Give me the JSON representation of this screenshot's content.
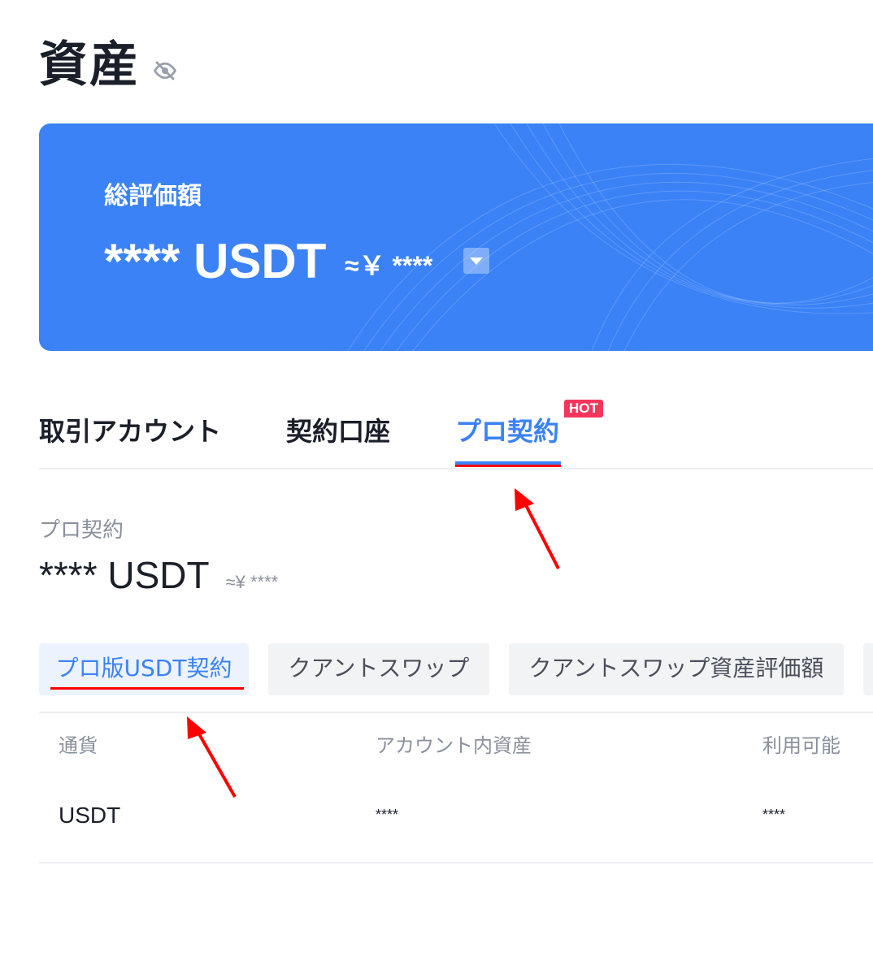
{
  "page": {
    "title": "資産"
  },
  "banner": {
    "label": "総評価額",
    "amount": "**** USDT",
    "approx": "≈￥ ****"
  },
  "tabs": [
    {
      "label": "取引アカウント"
    },
    {
      "label": "契約口座"
    },
    {
      "label": "プロ契約",
      "badge": "HOT",
      "active": true
    }
  ],
  "section": {
    "label": "プロ契約",
    "amount": "**** USDT",
    "approx": "≈¥ ****"
  },
  "subtabs": [
    {
      "label": "プロ版USDT契約",
      "active": true
    },
    {
      "label": "クアントスワップ"
    },
    {
      "label": "クアントスワップ資産評価額"
    }
  ],
  "table": {
    "headers": [
      "通貨",
      "アカウント内資産",
      "利用可能"
    ],
    "rows": [
      {
        "currency": "USDT",
        "account_assets": "****",
        "available": "****"
      }
    ]
  },
  "colors": {
    "accent": "#3b82f7",
    "hot_badge": "#f5365c",
    "annotation": "#ff0000"
  },
  "icons": {
    "visibility": "eye-off-icon",
    "dropdown": "caret-down-icon"
  }
}
